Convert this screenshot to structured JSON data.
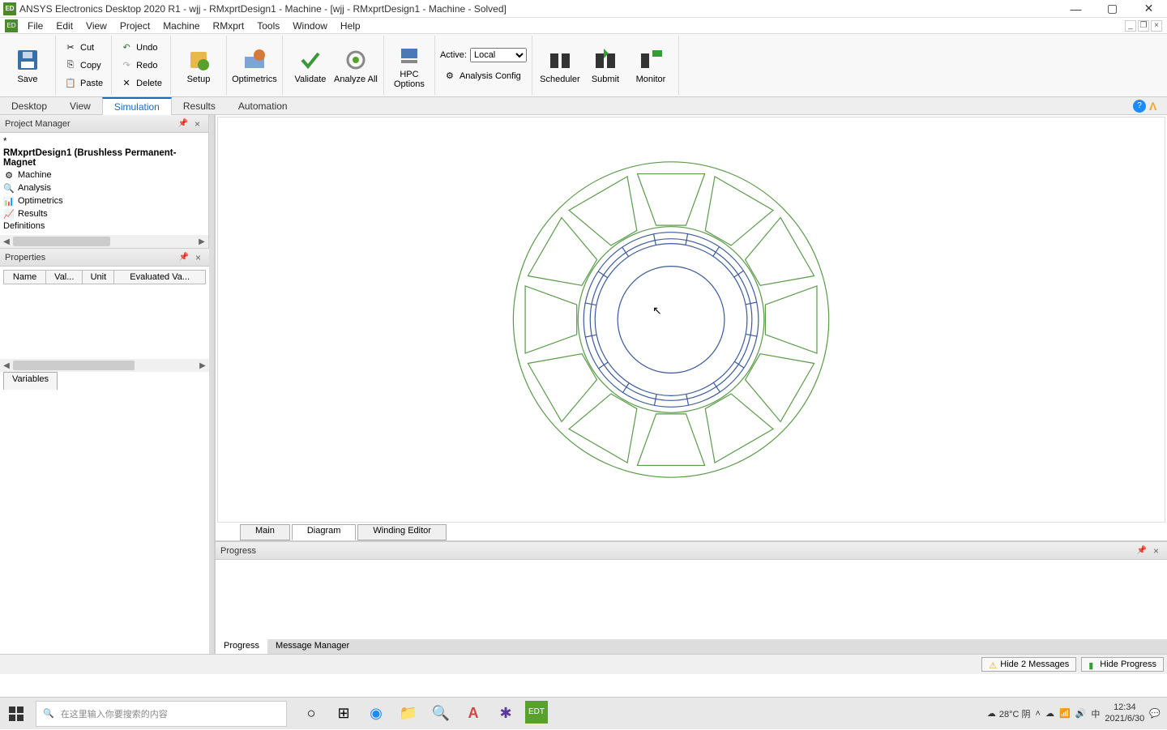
{
  "titlebar": {
    "title": "ANSYS Electronics Desktop 2020 R1 - wjj - RMxprtDesign1 - Machine - [wjj - RMxprtDesign1 - Machine - Solved]"
  },
  "menubar": {
    "items": [
      "File",
      "Edit",
      "View",
      "Project",
      "Machine",
      "RMxprt",
      "Tools",
      "Window",
      "Help"
    ]
  },
  "ribbon": {
    "save": "Save",
    "cut": "Cut",
    "copy": "Copy",
    "paste": "Paste",
    "undo": "Undo",
    "redo": "Redo",
    "delete": "Delete",
    "setup": "Setup",
    "optimetrics": "Optimetrics",
    "validate": "Validate",
    "analyze": "Analyze All",
    "hpc": "HPC Options",
    "active_label": "Active:",
    "active_value": "Local",
    "analysis_config": "Analysis Config",
    "scheduler": "Scheduler",
    "submit": "Submit",
    "monitor": "Monitor"
  },
  "ribbon_tabs": {
    "items": [
      "Desktop",
      "View",
      "Simulation",
      "Results",
      "Automation"
    ],
    "active": "Simulation"
  },
  "pm": {
    "title": "Project Manager",
    "star": "*",
    "design": "RMxprtDesign1 (Brushless Permanent-Magnet",
    "items": [
      "Machine",
      "Analysis",
      "Optimetrics",
      "Results",
      "Definitions"
    ]
  },
  "properties": {
    "title": "Properties",
    "cols": [
      "Name",
      "Val...",
      "Unit",
      "Evaluated Va..."
    ],
    "tab": "Variables"
  },
  "canvas_tabs": {
    "items": [
      "Main",
      "Diagram",
      "Winding Editor"
    ],
    "active": "Diagram"
  },
  "progress": {
    "title": "Progress",
    "tabs": [
      "Progress",
      "Message Manager"
    ],
    "active": "Progress"
  },
  "status": {
    "hide_msg": "Hide 2 Messages",
    "hide_prog": "Hide Progress"
  },
  "taskbar": {
    "search_placeholder": "在这里输入你要搜索的内容",
    "weather": "28°C 阴",
    "time": "12:34",
    "date": "2021/6/30",
    "ime": "中"
  }
}
